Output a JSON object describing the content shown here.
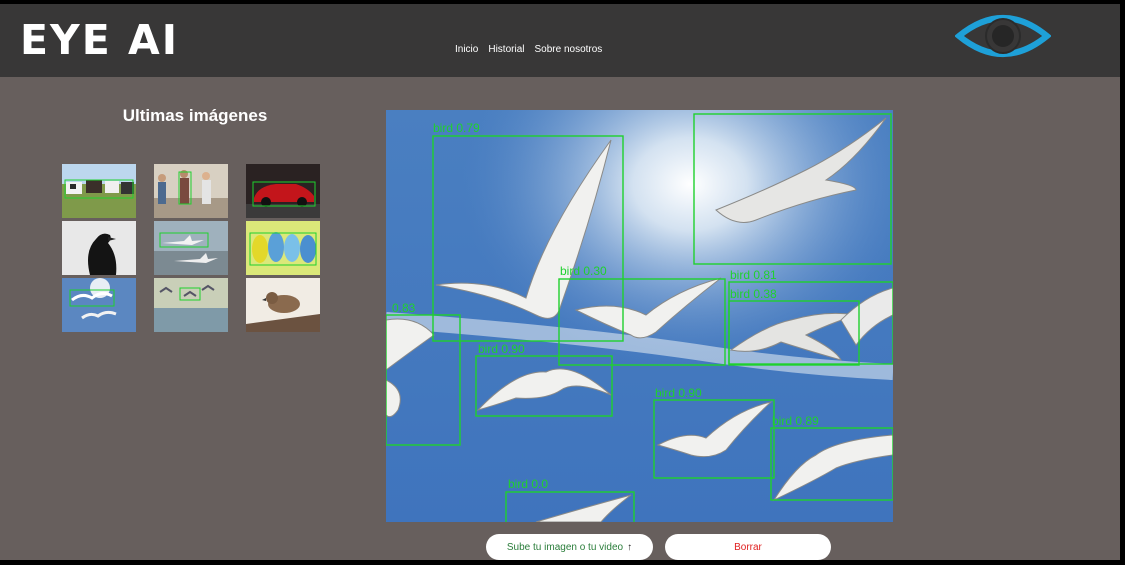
{
  "header": {
    "brand": "EYE AI",
    "nav": [
      "Inicio",
      "Historial",
      "Sobre nosotros"
    ]
  },
  "sidebar": {
    "title": "Ultimas imágenes",
    "thumbnails": [
      {
        "name": "thumb-cows",
        "subject": "cows"
      },
      {
        "name": "thumb-family",
        "subject": "people"
      },
      {
        "name": "thumb-car",
        "subject": "red car"
      },
      {
        "name": "thumb-crow",
        "subject": "crow"
      },
      {
        "name": "thumb-airport",
        "subject": "airplanes"
      },
      {
        "name": "thumb-parakeets",
        "subject": "parakeets"
      },
      {
        "name": "thumb-seagulls",
        "subject": "seagulls"
      },
      {
        "name": "thumb-birds-sky",
        "subject": "birds"
      },
      {
        "name": "thumb-sparrow",
        "subject": "sparrow"
      }
    ]
  },
  "detections": [
    {
      "label": "bird 0.79"
    },
    {
      "label": "bird 0.30"
    },
    {
      "label": "bird 0.81"
    },
    {
      "label": "bird 0.38"
    },
    {
      "label": "0.83"
    },
    {
      "label": "bird 0.90"
    },
    {
      "label": "bird 0.90"
    },
    {
      "label": "bird 0.89"
    },
    {
      "label": "bird 0.0"
    }
  ],
  "actions": {
    "upload_label": "Sube tu imagen o tu video",
    "upload_icon": "↑",
    "delete_label": "Borrar"
  },
  "colors": {
    "header_bg": "#383737",
    "page_bg": "#675f5d",
    "detection_box": "#1fd12d",
    "delete_text": "#e02020",
    "logo_blue": "#1ea0d8"
  }
}
